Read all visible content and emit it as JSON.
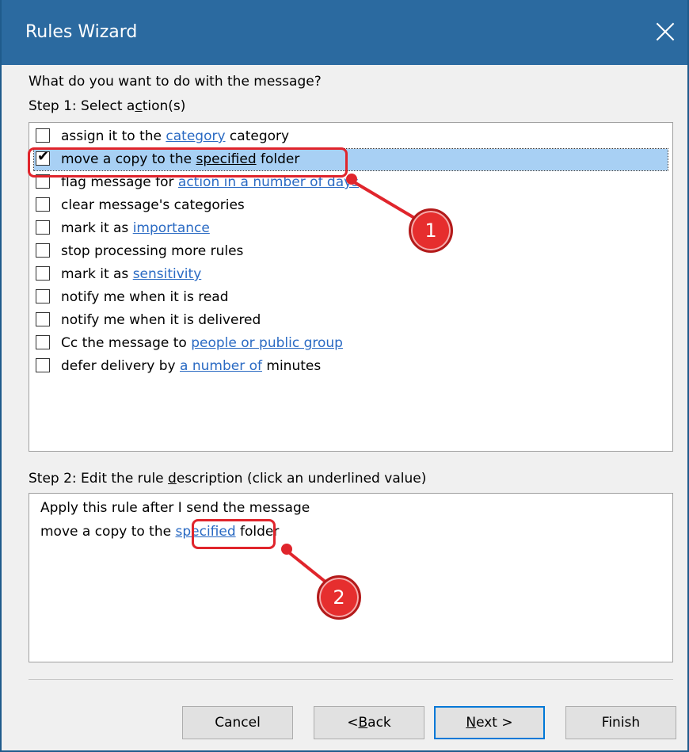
{
  "window": {
    "title": "Rules Wizard"
  },
  "prompt": "What do you want to do with the message?",
  "step1": {
    "pre": "Step 1: Select a",
    "u": "c",
    "post": "tion(s)"
  },
  "actions": [
    {
      "pre": "assign it to the ",
      "link": "category",
      "post": " category",
      "checked": false
    },
    {
      "pre": "move a copy to the ",
      "link": "specified",
      "post": " folder",
      "checked": true
    },
    {
      "pre": "flag message for ",
      "link": "action in a number of days",
      "post": "",
      "checked": false
    },
    {
      "pre": "clear message's categories",
      "link": "",
      "post": "",
      "checked": false
    },
    {
      "pre": "mark it as ",
      "link": "importance",
      "post": "",
      "checked": false
    },
    {
      "pre": "stop processing more rules",
      "link": "",
      "post": "",
      "checked": false
    },
    {
      "pre": "mark it as ",
      "link": "sensitivity",
      "post": "",
      "checked": false
    },
    {
      "pre": "notify me when it is read",
      "link": "",
      "post": "",
      "checked": false
    },
    {
      "pre": "notify me when it is delivered",
      "link": "",
      "post": "",
      "checked": false
    },
    {
      "pre": "Cc the message to ",
      "link": "people or public group",
      "post": "",
      "checked": false
    },
    {
      "pre": "defer delivery by ",
      "link": "a number of",
      "post": " minutes",
      "checked": false
    }
  ],
  "check_mark": "✔",
  "step2": {
    "pre": "Step 2: Edit the rule ",
    "u": "d",
    "post": "escription (click an underlined value)"
  },
  "description": {
    "line1": "Apply this rule after I send the message",
    "line2_pre": "move a copy to the ",
    "line2_link": "specified",
    "line2_post": " folder"
  },
  "buttons": {
    "cancel": "Cancel",
    "back_pre": "< ",
    "back_u": "B",
    "back_post": "ack",
    "next_u": "N",
    "next_post": "ext >",
    "finish": "Finish"
  },
  "annotations": {
    "badge1": "1",
    "badge2": "2"
  },
  "colors": {
    "title_bar": "#2b6aa0",
    "link": "#2a6ac3",
    "selection": "#a8d0f4",
    "annotation": "#e0252c"
  }
}
